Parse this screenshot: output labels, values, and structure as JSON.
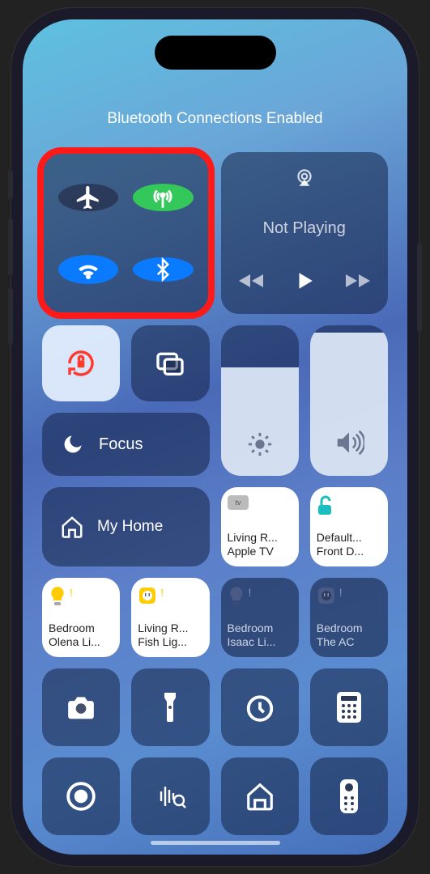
{
  "status_title": "Bluetooth Connections Enabled",
  "connectivity": {
    "airplane": {
      "active": false
    },
    "cellular": {
      "active": true,
      "color": "#34c759"
    },
    "wifi": {
      "active": true,
      "color": "#0a7aff"
    },
    "bluetooth": {
      "active": true,
      "color": "#0a7aff"
    },
    "highlighted": true
  },
  "media": {
    "title": "Not Playing"
  },
  "rotation_lock": {
    "active": true
  },
  "screen_mirror": {},
  "focus": {
    "label": "Focus"
  },
  "brightness": {
    "level_pct": 72
  },
  "volume": {
    "level_pct": 95
  },
  "home": {
    "label": "My Home",
    "tiles": [
      {
        "name": "living-room-appletv",
        "label": "Living R...",
        "sub": "Apple TV",
        "light": true,
        "icon": "appletv"
      },
      {
        "name": "default-front-door",
        "label": "Default...",
        "sub": "Front D...",
        "light": true,
        "icon": "lock"
      },
      {
        "name": "bedroom-olena-light",
        "label": "Bedroom",
        "sub": "Olena Li...",
        "light": true,
        "icon": "bulb-on"
      },
      {
        "name": "living-room-fish-light",
        "label": "Living R...",
        "sub": "Fish Lig...",
        "light": true,
        "icon": "bulb-on"
      },
      {
        "name": "bedroom-isaac-light",
        "label": "Bedroom",
        "sub": "Isaac Li...",
        "light": false,
        "icon": "bulb-off"
      },
      {
        "name": "bedroom-the-ac",
        "label": "Bedroom",
        "sub": "The AC",
        "light": false,
        "icon": "outlet"
      }
    ]
  },
  "bottom_row_1": [
    "camera",
    "flashlight",
    "timer",
    "calculator"
  ],
  "bottom_row_2": [
    "screen-record",
    "shazam",
    "home-app",
    "apple-tv-remote"
  ]
}
